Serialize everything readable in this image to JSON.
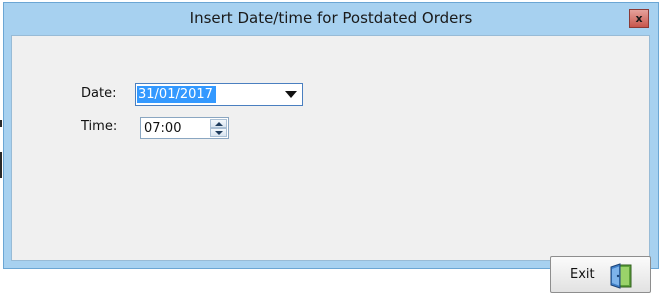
{
  "window": {
    "title": "Insert Date/time for Postdated Orders",
    "close_glyph": "x"
  },
  "form": {
    "date_label": "Date:",
    "date_value": "31/01/2017",
    "time_label": "Time:",
    "time_value": "07:00"
  },
  "buttons": {
    "exit_label": "Exit"
  },
  "icons": {
    "dropdown": "chevron-down-icon",
    "spin_up": "spin-up-icon",
    "spin_down": "spin-down-icon",
    "exit": "door-exit-icon"
  },
  "colors": {
    "title_bar": "#a7d1f0",
    "selection": "#3399ff",
    "close_button": "#c7564d",
    "client_bg": "#f0f0f0"
  }
}
